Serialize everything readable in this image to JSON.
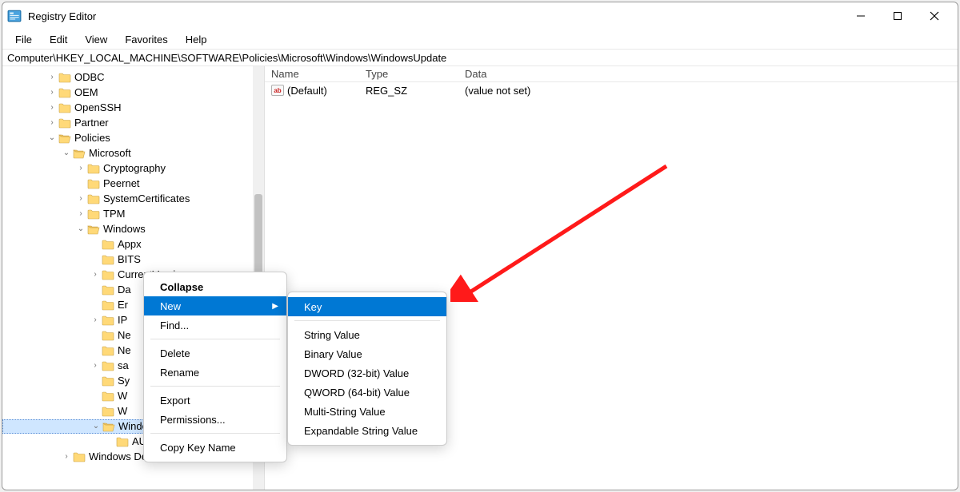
{
  "window": {
    "title": "Registry Editor"
  },
  "menubar": [
    "File",
    "Edit",
    "View",
    "Favorites",
    "Help"
  ],
  "address": "Computer\\HKEY_LOCAL_MACHINE\\SOFTWARE\\Policies\\Microsoft\\Windows\\WindowsUpdate",
  "tree": {
    "ODBC": {
      "indent": 3,
      "tw": ">"
    },
    "OEM": {
      "indent": 3,
      "tw": ">"
    },
    "OpenSSH": {
      "indent": 3,
      "tw": ">"
    },
    "Partner": {
      "indent": 3,
      "tw": ">"
    },
    "Policies": {
      "indent": 3,
      "tw": "v",
      "open": true
    },
    "Microsoft": {
      "indent": 4,
      "tw": "v",
      "open": true
    },
    "Cryptography": {
      "indent": 5,
      "tw": ">"
    },
    "Peernet": {
      "indent": 5,
      "tw": ""
    },
    "SystemCertificates": {
      "indent": 5,
      "tw": ">"
    },
    "TPM": {
      "indent": 5,
      "tw": ">"
    },
    "Windows": {
      "indent": 5,
      "tw": "v",
      "open": true
    },
    "Appx": {
      "indent": 6,
      "tw": ""
    },
    "BITS": {
      "indent": 6,
      "tw": ""
    },
    "CurrentVersion": {
      "indent": 6,
      "tw": ">"
    },
    "Da": {
      "indent": 6,
      "tw": "",
      "trunc": "Da"
    },
    "Er": {
      "indent": 6,
      "tw": "",
      "trunc": "Er"
    },
    "IP": {
      "indent": 6,
      "tw": ">",
      "trunc": "IP"
    },
    "Ne1": {
      "indent": 6,
      "tw": "",
      "trunc": "Ne"
    },
    "Ne2": {
      "indent": 6,
      "tw": "",
      "trunc": "Ne"
    },
    "sa": {
      "indent": 6,
      "tw": ">",
      "trunc": "sa"
    },
    "Sy": {
      "indent": 6,
      "tw": "",
      "trunc": "Sy"
    },
    "W1": {
      "indent": 6,
      "tw": "",
      "trunc": "W"
    },
    "W2": {
      "indent": 6,
      "tw": "",
      "trunc": "W"
    },
    "WindowsUpdate": {
      "indent": 6,
      "tw": "v",
      "open": true,
      "selected": true,
      "trunc": "WindowsUpdate"
    },
    "AU": {
      "indent": 7,
      "tw": ""
    },
    "WindowsDefender": {
      "indent": 4,
      "tw": ">",
      "label": "Windows Defender"
    }
  },
  "tree_order": [
    "ODBC",
    "OEM",
    "OpenSSH",
    "Partner",
    "Policies",
    "Microsoft",
    "Cryptography",
    "Peernet",
    "SystemCertificates",
    "TPM",
    "Windows",
    "Appx",
    "BITS",
    "CurrentVersion",
    "Da",
    "Er",
    "IP",
    "Ne1",
    "Ne2",
    "sa",
    "Sy",
    "W1",
    "W2",
    "WindowsUpdate",
    "AU",
    "WindowsDefender"
  ],
  "list": {
    "headers": {
      "name": "Name",
      "type": "Type",
      "data": "Data"
    },
    "rows": [
      {
        "name": "(Default)",
        "type": "REG_SZ",
        "data": "(value not set)"
      }
    ]
  },
  "context_menu": {
    "items": [
      {
        "label": "Collapse",
        "bold": true
      },
      {
        "label": "New",
        "selected": true,
        "submenu": true
      },
      {
        "label": "Find..."
      },
      {
        "sep": true
      },
      {
        "label": "Delete"
      },
      {
        "label": "Rename"
      },
      {
        "sep": true
      },
      {
        "label": "Export"
      },
      {
        "label": "Permissions..."
      },
      {
        "sep": true
      },
      {
        "label": "Copy Key Name"
      }
    ]
  },
  "submenu": {
    "items": [
      {
        "label": "Key",
        "selected": true
      },
      {
        "sep": true
      },
      {
        "label": "String Value"
      },
      {
        "label": "Binary Value"
      },
      {
        "label": "DWORD (32-bit) Value"
      },
      {
        "label": "QWORD (64-bit) Value"
      },
      {
        "label": "Multi-String Value"
      },
      {
        "label": "Expandable String Value"
      }
    ]
  }
}
